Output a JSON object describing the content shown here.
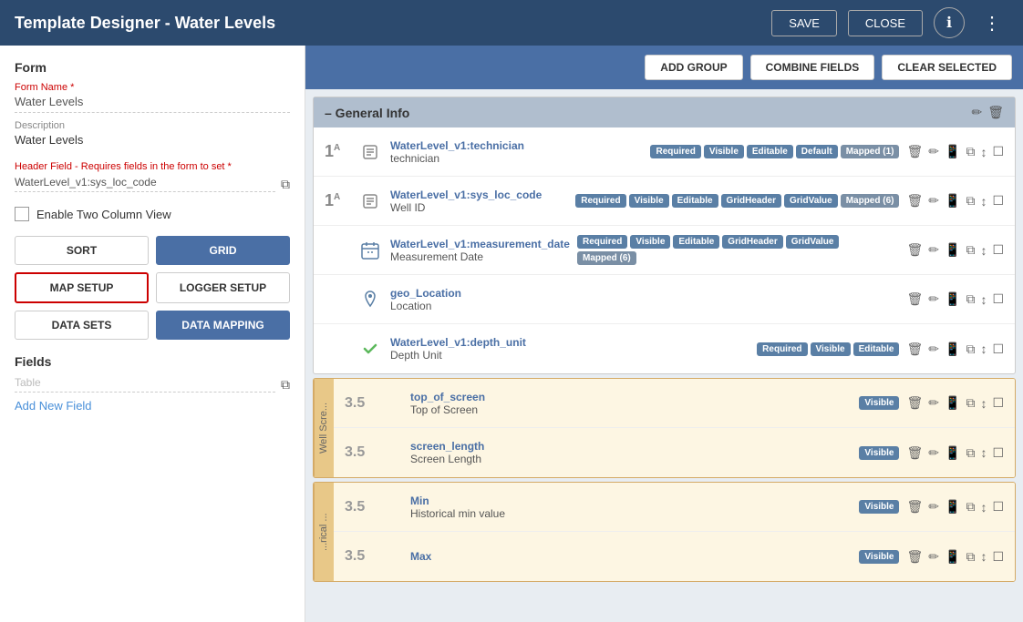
{
  "header": {
    "title": "Template Designer - Water Levels",
    "save_label": "SAVE",
    "close_label": "CLOSE",
    "info_icon": "ℹ",
    "menu_icon": "⋮"
  },
  "toolbar": {
    "add_group_label": "ADD GROUP",
    "combine_fields_label": "COMBINE FIELDS",
    "clear_selected_label": "CLEAR SELECTED"
  },
  "left_panel": {
    "form_section_title": "Form",
    "form_name_label": "Form Name *",
    "form_name_value": "Water Levels",
    "description_label": "Description",
    "description_value": "Water Levels",
    "header_field_label": "Header Field - Requires fields in the form to set *",
    "header_field_value": "WaterLevel_v1:sys_loc_code",
    "two_col_label": "Enable Two Column View",
    "buttons": {
      "sort": "SORT",
      "grid": "GRID",
      "map_setup": "MAP SETUP",
      "logger_setup": "LOGGER SETUP",
      "data_sets": "DATA SETS",
      "data_mapping": "DATA MAPPING"
    },
    "fields_section": {
      "title": "Fields",
      "table_placeholder": "Table",
      "add_field_link": "Add New Field"
    }
  },
  "groups": [
    {
      "id": "general-info",
      "title": "– General Info",
      "fields": [
        {
          "number": "1A",
          "icon": "text",
          "field_name": "WaterLevel_v1:technician",
          "field_label": "technician",
          "tags": [
            "Required",
            "Visible",
            "Editable",
            "Default"
          ],
          "mapped": "Mapped (1)"
        },
        {
          "number": "1A",
          "icon": "text",
          "field_name": "WaterLevel_v1:sys_loc_code",
          "field_label": "Well ID",
          "tags": [
            "Required",
            "Visible",
            "Editable",
            "GridHeader",
            "GridValue"
          ],
          "mapped": "Mapped (6)"
        },
        {
          "number": "",
          "icon": "calendar",
          "field_name": "WaterLevel_v1:measurement_date",
          "field_label": "Measurement Date",
          "tags": [
            "Required",
            "Visible",
            "Editable",
            "GridHeader",
            "GridValue"
          ],
          "mapped": "Mapped (6)"
        },
        {
          "number": "",
          "icon": "location",
          "field_name": "geo_Location",
          "field_label": "Location",
          "tags": [],
          "mapped": ""
        },
        {
          "number": "",
          "icon": "check",
          "field_name": "WaterLevel_v1:depth_unit",
          "field_label": "Depth Unit",
          "tags": [
            "Required",
            "Visible",
            "Editable"
          ],
          "mapped": ""
        }
      ]
    }
  ],
  "sub_groups": [
    {
      "id": "well-screen",
      "label": "Well Scre...",
      "fields": [
        {
          "number": "3.5",
          "field_name": "top_of_screen",
          "field_label": "Top of Screen",
          "tags": [
            "Visible"
          ]
        },
        {
          "number": "3.5",
          "field_name": "screen_length",
          "field_label": "Screen Length",
          "tags": [
            "Visible"
          ]
        }
      ]
    },
    {
      "id": "historical",
      "label": "...rical ...",
      "fields": [
        {
          "number": "3.5",
          "field_name": "Min",
          "field_label": "Historical min value",
          "tags": [
            "Visible"
          ]
        },
        {
          "number": "3.5",
          "field_name": "Max",
          "field_label": "",
          "tags": [
            "Visible"
          ]
        }
      ]
    }
  ],
  "tag_colors": {
    "Required": "#5a7fa5",
    "Visible": "#5a7fa5",
    "Editable": "#5a7fa5",
    "Default": "#5a7fa5",
    "GridHeader": "#5a7fa5",
    "GridValue": "#5a7fa5",
    "Mapped": "#7a8fa5"
  }
}
